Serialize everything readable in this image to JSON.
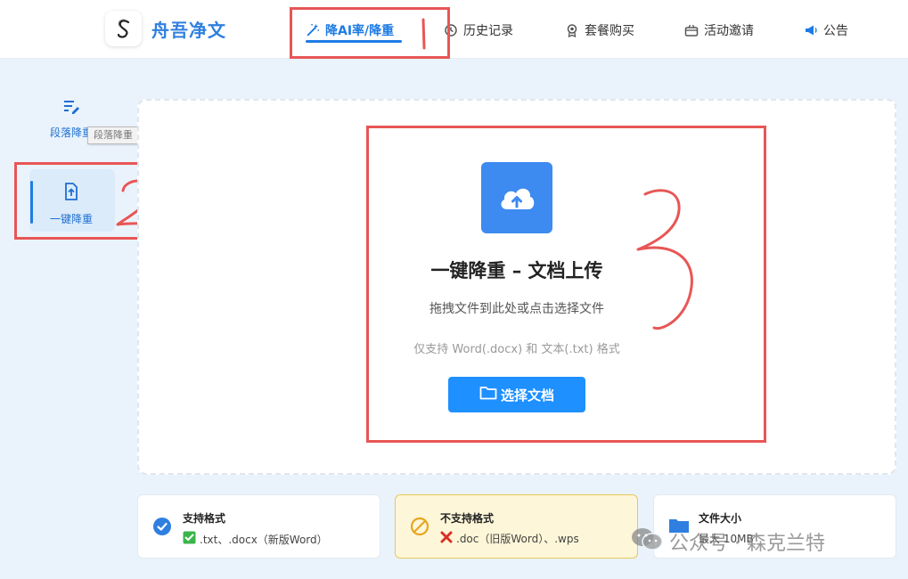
{
  "header": {
    "brand": "舟吾净文",
    "nav": [
      {
        "label": "降AI率/降重",
        "icon": "magic-wand-icon",
        "active": true
      },
      {
        "label": "历史记录",
        "icon": "clock-icon"
      },
      {
        "label": "套餐购买",
        "icon": "badge-icon"
      },
      {
        "label": "活动邀请",
        "icon": "gift-box-icon"
      },
      {
        "label": "公告",
        "icon": "megaphone-icon"
      }
    ]
  },
  "sidebar": {
    "items": [
      {
        "label": "段落降重",
        "icon": "paragraph-edit-icon"
      },
      {
        "label": "一键降重",
        "icon": "file-upload-icon",
        "active": true
      }
    ],
    "tooltip": "段落降重"
  },
  "upload": {
    "icon": "cloud-upload-icon",
    "title": "一键降重 – 文档上传",
    "subtitle": "拖拽文件到此处或点击选择文件",
    "hint": "仅支持 Word(.docx) 和 文本(.txt) 格式",
    "button_label": "选择文档"
  },
  "cards": [
    {
      "title": "支持格式",
      "text": ".txt、.docx（新版Word）",
      "icon": "check-circle-icon"
    },
    {
      "title": "不支持格式",
      "text": ".doc（旧版Word）、.wps",
      "icon": "forbidden-icon"
    },
    {
      "title": "文件大小",
      "text": "最大 10MB",
      "icon": "folder-icon"
    }
  ],
  "annotations": [
    "1",
    "2",
    "3"
  ],
  "watermark": "公众号 · 森克兰特",
  "colors": {
    "accent": "#1e7be5",
    "button": "#1e90ff",
    "annotation": "#e85656",
    "warn_bg": "#fdf6d8"
  }
}
